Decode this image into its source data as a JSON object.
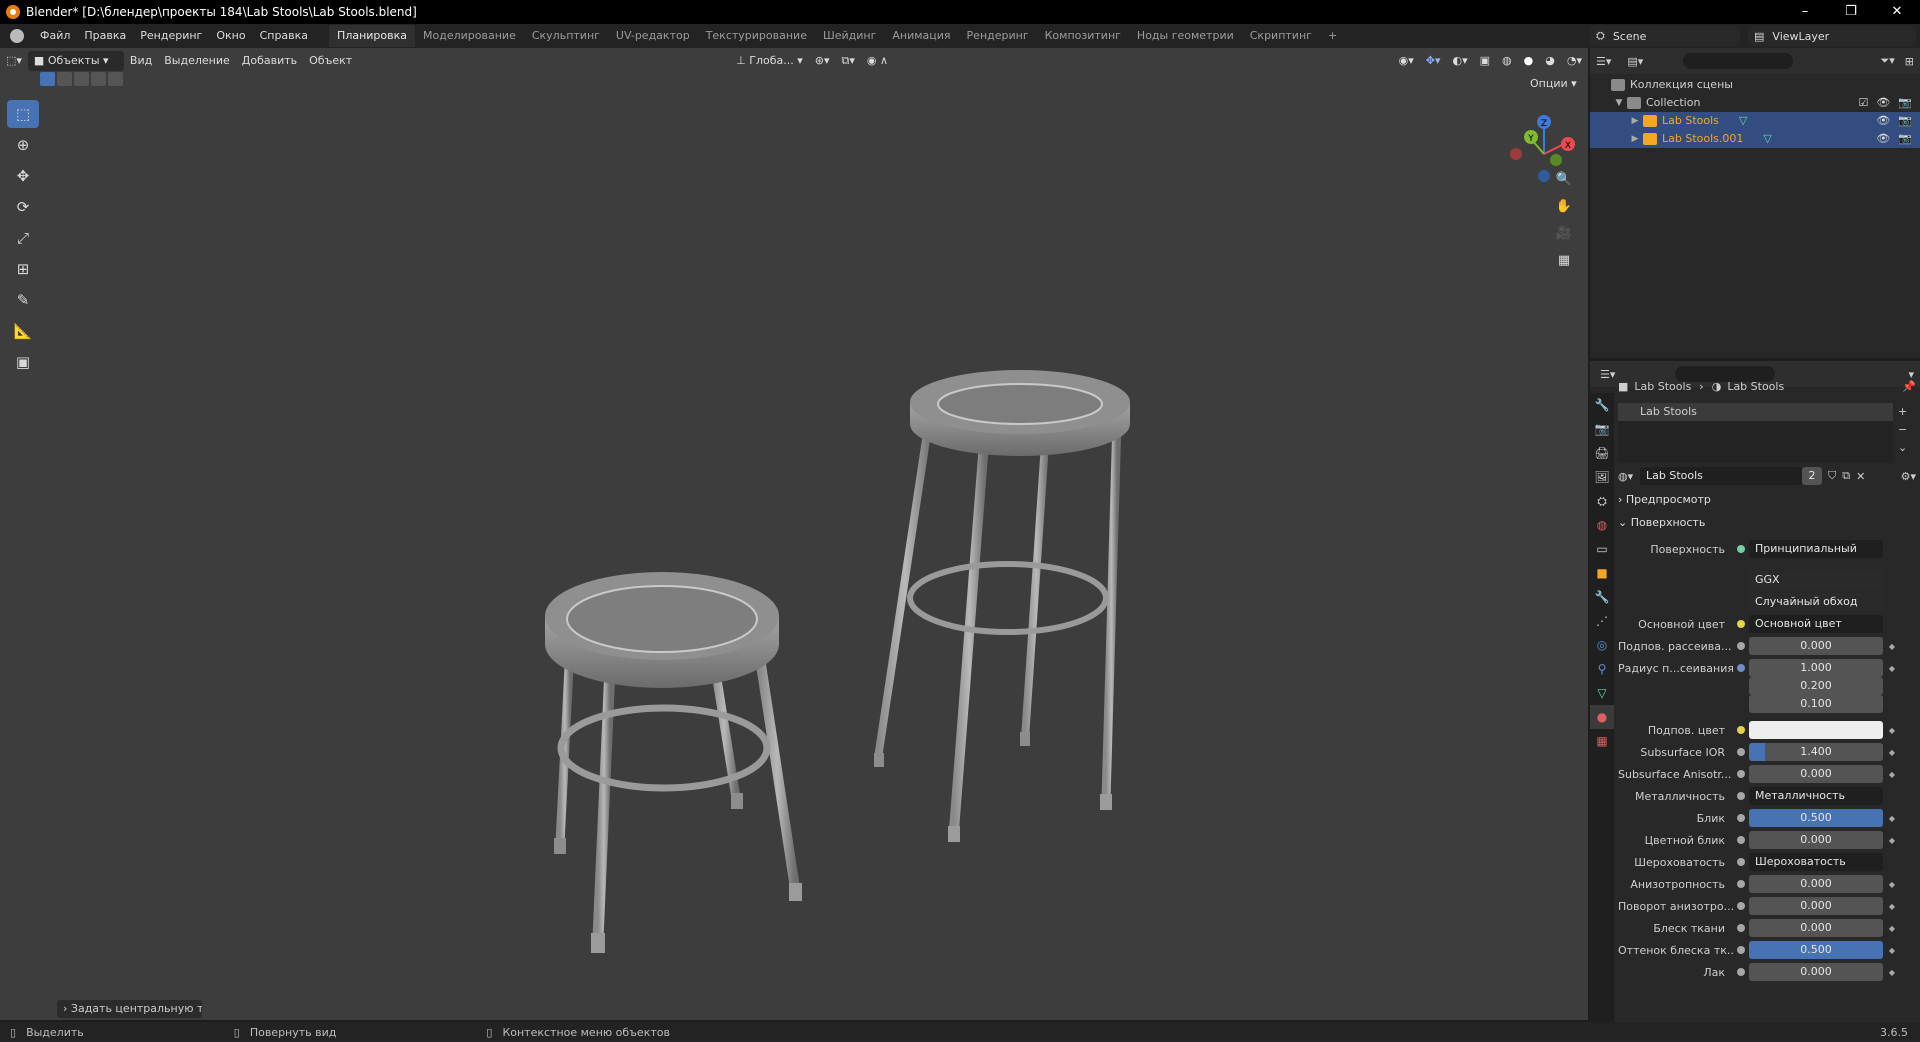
{
  "window": {
    "title": "Blender* [D:\\блендер\\проекты 184\\Lab Stools\\Lab Stools.blend]",
    "minimize": "–",
    "maximize": "❐",
    "close": "✕"
  },
  "menu": [
    "Файл",
    "Правка",
    "Рендеринг",
    "Окно",
    "Справка"
  ],
  "workspaces": [
    "Планировка",
    "Моделирование",
    "Скульптинг",
    "UV-редактор",
    "Текстурирование",
    "Шейдинг",
    "Анимация",
    "Рендеринг",
    "Композитинг",
    "Ноды геометрии",
    "Скриптинг"
  ],
  "workspace_active": "Планировка",
  "workspace_add": "+",
  "scene_name": "Scene",
  "view_layer": "ViewLayer",
  "viewport": {
    "mode": "Объекты",
    "menus": [
      "Вид",
      "Выделение",
      "Добавить",
      "Объект"
    ],
    "orientation": "Глоба...",
    "options": "Опции",
    "last_operator": "Задать центральную точк"
  },
  "gizmo": {
    "x": "X",
    "y": "Y",
    "z": "Z"
  },
  "outliner": {
    "root": "Коллекция сцены",
    "collection": "Collection",
    "items": [
      {
        "name": "Lab Stools",
        "color": "#f5a623"
      },
      {
        "name": "Lab Stools.001",
        "color": "#f5a623"
      }
    ]
  },
  "properties": {
    "breadcrumb_object": "Lab Stools",
    "breadcrumb_material": "Lab Stools",
    "material_slot": "Lab Stools",
    "material_name": "Lab Stools",
    "material_users": "2",
    "panels": {
      "preview": "Предпросмотр",
      "surface": "Поверхность"
    },
    "surface": {
      "surface_label": "Поверхность",
      "surface_value": "Принципиальный BSDF",
      "distribution": "GGX",
      "subsurface_method": "Случайный обход",
      "base_color_label": "Основной цвет",
      "base_color_value": "Основной цвет",
      "subsurface_label": "Подпов. рассеива...",
      "subsurface_value": "0.000",
      "radius_label": "Радиус п...сеивания",
      "radius_values": [
        "1.000",
        "0.200",
        "0.100"
      ],
      "subsurface_color_label": "Подпов. цвет",
      "ior_label": "Subsurface IOR",
      "ior_value": "1.400",
      "ior_fraction": 0.12,
      "anisotropy_label": "Subsurface Anisotr...",
      "anisotropy_value": "0.000",
      "metallic_label": "Металличность",
      "metallic_value": "Металличность",
      "specular_label": "Блик",
      "specular_value": "0.500",
      "specular_fraction": 1.0,
      "specular_tint_label": "Цветной блик",
      "specular_tint_value": "0.000",
      "roughness_label": "Шероховатость",
      "roughness_value": "Шероховатость",
      "anisotropic_label": "Анизотропность",
      "anisotropic_value": "0.000",
      "aniso_rot_label": "Поворот анизотро...",
      "aniso_rot_value": "0.000",
      "sheen_label": "Блеск ткани",
      "sheen_value": "0.000",
      "sheen_tint_label": "Оттенок блеска тк...",
      "sheen_tint_value": "0.500",
      "sheen_tint_fraction": 1.0,
      "clearcoat_label": "Лак",
      "clearcoat_value": "0.000"
    }
  },
  "status": {
    "select": "Выделить",
    "rotate": "Повернуть вид",
    "context": "Контекстное меню объектов",
    "version": "3.6.5"
  },
  "colors": {
    "accent": "#4772b3",
    "selected_row": "#334d80",
    "object_orange": "#f5a623"
  }
}
